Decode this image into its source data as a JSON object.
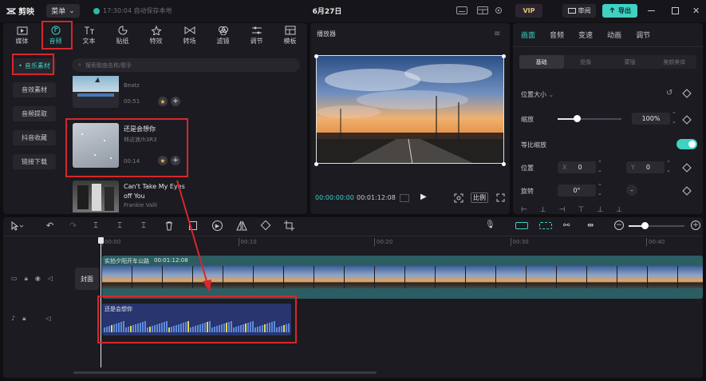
{
  "app": {
    "name": "剪映",
    "menu_label": "菜单",
    "autosave": "17:30:04 自动保存本地",
    "doc_title": "6月27日",
    "vip_label": "VIP",
    "review_label": "审阅",
    "export_label": "导出"
  },
  "media_tabs": [
    {
      "label": "媒体",
      "icon": "media-icon"
    },
    {
      "label": "音频",
      "icon": "audio-icon",
      "active": true
    },
    {
      "label": "文本",
      "icon": "text-icon"
    },
    {
      "label": "贴纸",
      "icon": "sticker-icon"
    },
    {
      "label": "特效",
      "icon": "effect-icon"
    },
    {
      "label": "转场",
      "icon": "transition-icon"
    },
    {
      "label": "滤镜",
      "icon": "filter-icon"
    },
    {
      "label": "调节",
      "icon": "adjust-icon"
    },
    {
      "label": "模板",
      "icon": "template-icon"
    }
  ],
  "audio_sidebar": [
    {
      "label": "音乐素材",
      "active": true
    },
    {
      "label": "音效素材"
    },
    {
      "label": "音频提取"
    },
    {
      "label": "抖音收藏"
    },
    {
      "label": "链接下载"
    }
  ],
  "search_placeholder": "搜索歌曲名称/歌手",
  "music_list": [
    {
      "title": "",
      "artist": "Beatz",
      "duration": "00:51"
    },
    {
      "title": "还是会想你",
      "artist": "林达浪/h3R3",
      "duration": "00:14"
    },
    {
      "title": "Can't Take My Eyes off You",
      "artist": "Frankie Valli",
      "duration": ""
    }
  ],
  "player": {
    "title": "播放器",
    "current_time": "00:00:00:00",
    "total_time": "00:01:12:08",
    "ratio_label": "比例"
  },
  "props": {
    "tabs": [
      "画面",
      "音频",
      "变速",
      "动画",
      "调节"
    ],
    "segments": [
      "基础",
      "抠像",
      "蒙版",
      "美颜美体"
    ],
    "position_size": "位置大小",
    "scale_label": "缩放",
    "scale_value": "100%",
    "scale_level": 0.3,
    "uniform_scale": "等比缩放",
    "uniform_scale_on": true,
    "position_label": "位置",
    "pos_x_label": "X",
    "pos_x": "0",
    "pos_y_label": "Y",
    "pos_y": "0",
    "rotate_label": "旋转",
    "rotate_value": "0°"
  },
  "timeline": {
    "ruler": [
      "00:00",
      "00:10",
      "00:20",
      "00:30",
      "00:40"
    ],
    "video_clip": {
      "name": "实拍夕阳开车公路",
      "duration": "00:01:12:08"
    },
    "cover_label": "封面",
    "audio_clip": {
      "name": "还是会想你"
    }
  },
  "colors": {
    "accent": "#3fd1c2",
    "highlight_box": "#d8262b"
  }
}
